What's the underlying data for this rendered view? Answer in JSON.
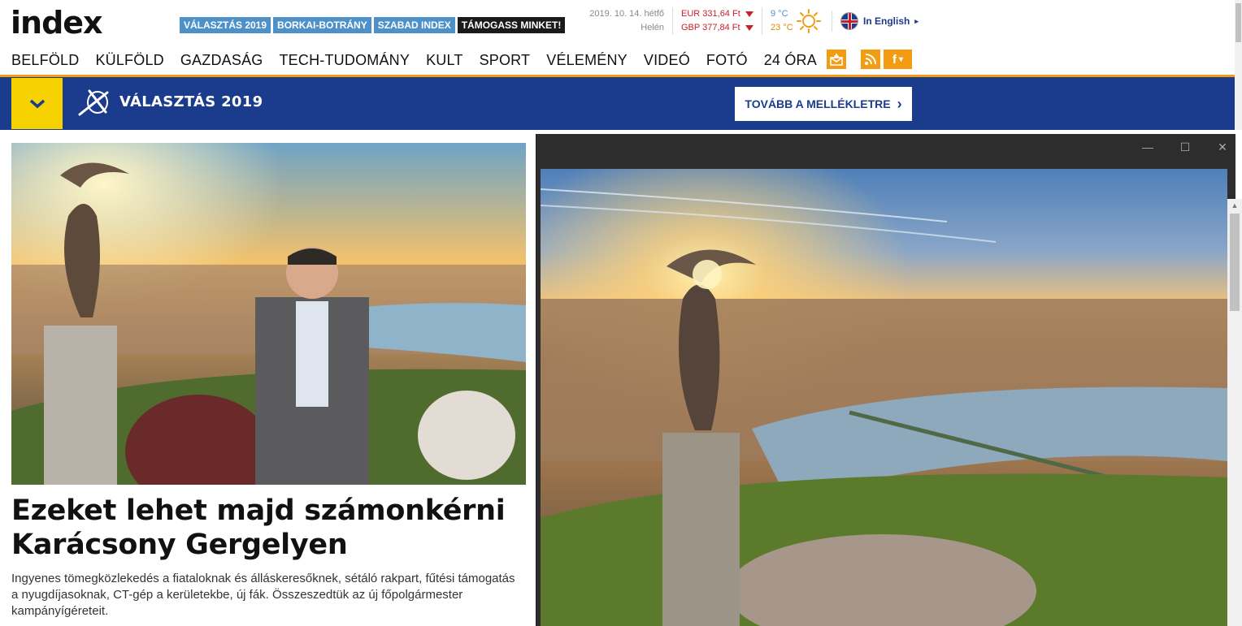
{
  "header": {
    "logo": "index",
    "tags": [
      "VÁLASZTÁS 2019",
      "BORKAI-BOTRÁNY",
      "SZABAD INDEX",
      "TÁMOGASS MINKET!"
    ],
    "date": "2019. 10. 14. hétfő",
    "nameday": "Helén",
    "rates": [
      "EUR 331,64 Ft",
      "GBP 377,84 Ft"
    ],
    "temps": [
      "9 °C",
      "23 °C"
    ],
    "lang_label": "In English",
    "lang_arrow": "▸"
  },
  "nav": {
    "items": [
      "BELFÖLD",
      "KÜLFÖLD",
      "GAZDASÁG",
      "TECH-TUDOMÁNY",
      "KULT",
      "SPORT",
      "VÉLEMÉNY",
      "VIDEÓ",
      "FOTÓ",
      "24 ÓRA"
    ]
  },
  "social": {
    "fb_label": "f",
    "fb_arrow": "▾"
  },
  "banner": {
    "title": "VÁLASZTÁS 2019",
    "button_label": "TOVÁBB A MELLÉKLETRE",
    "button_arrow": "›"
  },
  "article": {
    "headline": "Ezeket lehet majd számonkérni Karácsony Gergelyen",
    "lead": "Ingyenes tömegközlekedés a fiataloknak és álláskeresőknek, sétáló rakpart, fűtési támogatás a nyugdíjasoknak, CT-gép a kerületekbe, új fák. Összeszedtük az új főpolgármester kampányígéreteit."
  },
  "viewer": {
    "min_icon": "—",
    "max_icon": "☐",
    "close_icon": "✕"
  },
  "colors": {
    "accent": "#f39c12",
    "banner_blue": "#1b3c8c",
    "tag_blue": "#4d91c8",
    "banner_yellow": "#f6d200"
  }
}
